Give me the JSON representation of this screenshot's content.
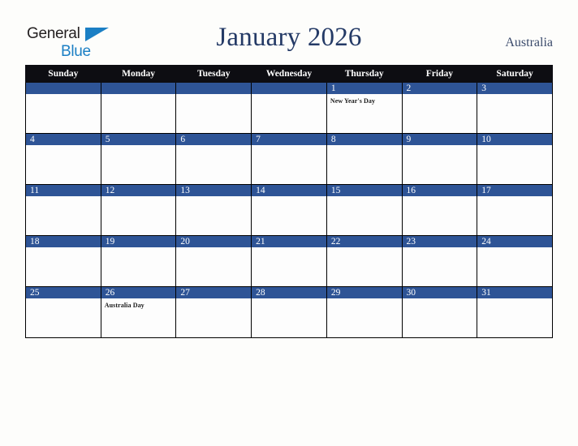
{
  "brand": {
    "name_part1": "General",
    "name_part2": "Blue",
    "triangle_icon": "triangle-icon",
    "color_dark": "#231f20",
    "color_blue": "#1b7fc4"
  },
  "header": {
    "title": "January 2026",
    "region": "Australia",
    "title_color": "#243a66"
  },
  "calendar": {
    "accent_color": "#2e5496",
    "header_color": "#0d0d12",
    "weekday_headers": [
      "Sunday",
      "Monday",
      "Tuesday",
      "Wednesday",
      "Thursday",
      "Friday",
      "Saturday"
    ],
    "weeks": [
      [
        {
          "day": "",
          "event": ""
        },
        {
          "day": "",
          "event": ""
        },
        {
          "day": "",
          "event": ""
        },
        {
          "day": "",
          "event": ""
        },
        {
          "day": "1",
          "event": "New Year's Day"
        },
        {
          "day": "2",
          "event": ""
        },
        {
          "day": "3",
          "event": ""
        }
      ],
      [
        {
          "day": "4",
          "event": ""
        },
        {
          "day": "5",
          "event": ""
        },
        {
          "day": "6",
          "event": ""
        },
        {
          "day": "7",
          "event": ""
        },
        {
          "day": "8",
          "event": ""
        },
        {
          "day": "9",
          "event": ""
        },
        {
          "day": "10",
          "event": ""
        }
      ],
      [
        {
          "day": "11",
          "event": ""
        },
        {
          "day": "12",
          "event": ""
        },
        {
          "day": "13",
          "event": ""
        },
        {
          "day": "14",
          "event": ""
        },
        {
          "day": "15",
          "event": ""
        },
        {
          "day": "16",
          "event": ""
        },
        {
          "day": "17",
          "event": ""
        }
      ],
      [
        {
          "day": "18",
          "event": ""
        },
        {
          "day": "19",
          "event": ""
        },
        {
          "day": "20",
          "event": ""
        },
        {
          "day": "21",
          "event": ""
        },
        {
          "day": "22",
          "event": ""
        },
        {
          "day": "23",
          "event": ""
        },
        {
          "day": "24",
          "event": ""
        }
      ],
      [
        {
          "day": "25",
          "event": ""
        },
        {
          "day": "26",
          "event": "Australia Day"
        },
        {
          "day": "27",
          "event": ""
        },
        {
          "day": "28",
          "event": ""
        },
        {
          "day": "29",
          "event": ""
        },
        {
          "day": "30",
          "event": ""
        },
        {
          "day": "31",
          "event": ""
        }
      ]
    ]
  }
}
